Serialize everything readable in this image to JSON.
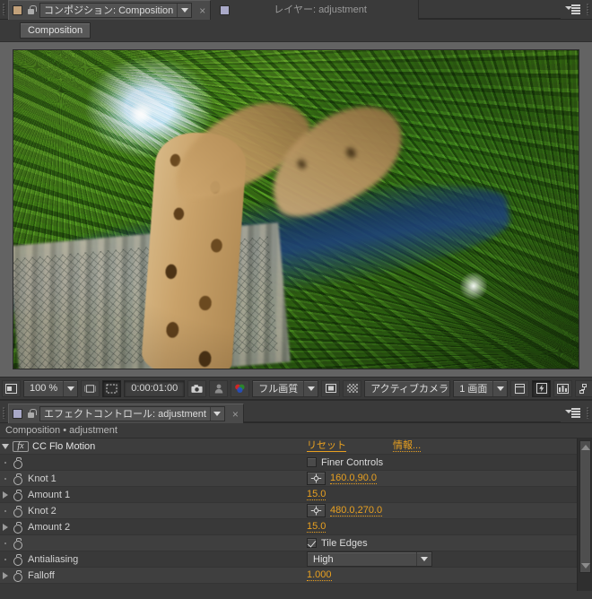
{
  "app": {
    "accent": "#e8a020",
    "panel_bg": "#3a3a3a",
    "row_bg": "#3d3d3d"
  },
  "composition_panel": {
    "tabs": [
      {
        "label": "コンポジション: Composition",
        "active": true,
        "swatch": "#c2a17a",
        "close": "×"
      },
      {
        "label": "レイヤー: adjustment",
        "active": false,
        "swatch": "#a9a9c8",
        "close": ""
      }
    ],
    "menu_icon": "panel-menu-icon",
    "comp_button": "Composition",
    "viewer": {
      "image_alt": "giraffe radial blur composition preview"
    },
    "toolbar": {
      "always_preview_icon": "always-preview-icon",
      "zoom_value": "100 %",
      "zoom_caret": "chevron-down-icon",
      "resolution_icon": "region-of-interest-icon",
      "roi_icon": "mask-region-icon",
      "timecode": "0:00:01:00",
      "snapshot_icon": "camera-icon",
      "show_snapshot_icon": "show-snapshot-icon",
      "channels_icon": "channels-rgb-icon",
      "quality_value": "フル画質",
      "quality_caret": "chevron-down-icon",
      "region_icon": "region-of-interest-icon",
      "transparency_icon": "transparency-grid-icon",
      "camera_value": "アクティブカメラ",
      "camera_caret": "chevron-down-icon",
      "views_value": "1 画面",
      "views_caret": "chevron-down-icon",
      "pixel_aspect_icon": "pixel-aspect-correction-icon",
      "fast_preview_icon": "fast-preview-icon",
      "timeline_icon": "timeline-icon",
      "comp_flowchart_icon": "comp-flowchart-icon"
    }
  },
  "effect_controls_panel": {
    "tabs": [
      {
        "label": "エフェクトコントロール: adjustment",
        "active": true,
        "swatch": "#a9a9c8",
        "close": "×"
      }
    ],
    "menu_icon": "panel-menu-icon",
    "subtitle": "Composition • adjustment",
    "effect": {
      "name": "CC Flo Motion",
      "fx_badge": "fx",
      "reset_label": "リセット",
      "about_label": "情報...",
      "expanded": true
    },
    "params": [
      {
        "name": "",
        "type": "checkbox",
        "value_label": "Finer Controls",
        "checked": false,
        "twirl": "none",
        "stopwatch": true
      },
      {
        "name": "Knot 1",
        "type": "point",
        "value": "160.0,90.0",
        "twirl": "none",
        "stopwatch": true,
        "point_icon": "point-picker-icon"
      },
      {
        "name": "Amount 1",
        "type": "number",
        "value": "15.0",
        "twirl": "collapsed",
        "stopwatch": true
      },
      {
        "name": "Knot 2",
        "type": "point",
        "value": "480.0,270.0",
        "twirl": "none",
        "stopwatch": true,
        "point_icon": "point-picker-icon"
      },
      {
        "name": "Amount 2",
        "type": "number",
        "value": "15.0",
        "twirl": "collapsed",
        "stopwatch": true
      },
      {
        "name": "",
        "type": "checkbox",
        "value_label": "Tile Edges",
        "checked": true,
        "twirl": "none",
        "stopwatch": true
      },
      {
        "name": "Antialiasing",
        "type": "select",
        "value": "High",
        "twirl": "none",
        "stopwatch": true
      },
      {
        "name": "Falloff",
        "type": "number",
        "value": "1.000",
        "twirl": "collapsed",
        "stopwatch": true
      }
    ],
    "scrollbar": {
      "up_icon": "scroll-up-arrow-icon",
      "down_icon": "scroll-down-arrow-icon"
    }
  }
}
